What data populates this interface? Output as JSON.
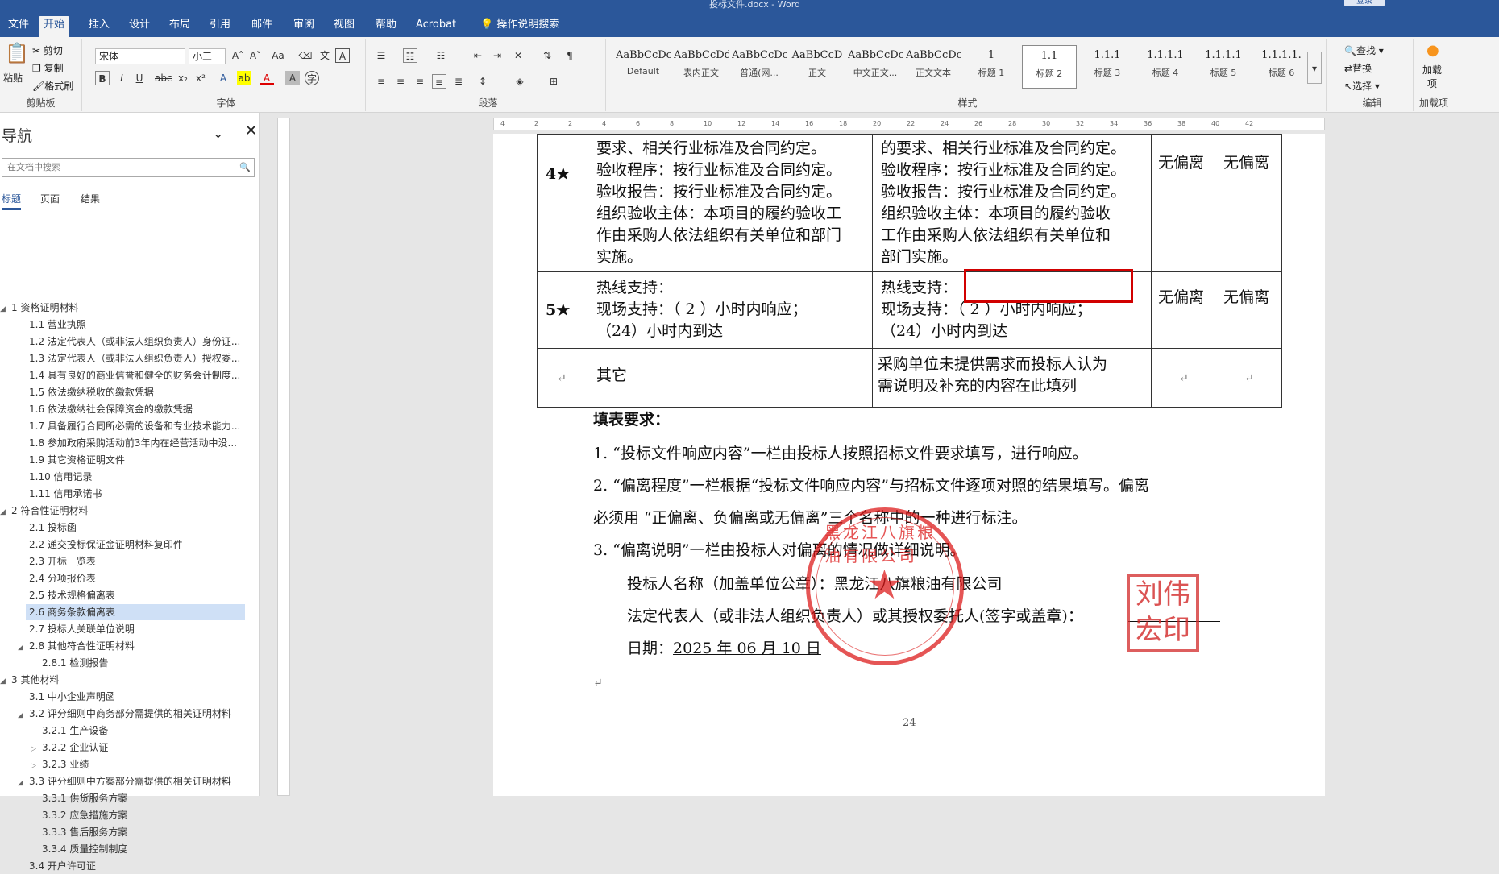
{
  "window": {
    "title": "投标文件.docx - Word",
    "login_btn": "登录"
  },
  "tabs": [
    "文件",
    "开始",
    "插入",
    "设计",
    "布局",
    "引用",
    "邮件",
    "审阅",
    "视图",
    "帮助",
    "Acrobat",
    "操作说明搜索"
  ],
  "clipboard": {
    "paste": "粘贴",
    "cut": "剪切",
    "copy": "复制",
    "format_painter": "格式刷",
    "group": "剪贴板"
  },
  "font": {
    "name": "宋体",
    "size": "小三",
    "group": "字体"
  },
  "paragraph": {
    "group": "段落"
  },
  "styles": {
    "group": "样式",
    "items": [
      {
        "preview": "AaBbCcDc",
        "name": "Default"
      },
      {
        "preview": "AaBbCcDdI",
        "name": "表内正文"
      },
      {
        "preview": "AaBbCcDc",
        "name": "普通(网..."
      },
      {
        "preview": "AaBbCcD",
        "name": "正文"
      },
      {
        "preview": "AaBbCcDc",
        "name": "中文正文..."
      },
      {
        "preview": "AaBbCcDc",
        "name": "正文文本"
      },
      {
        "preview": "1",
        "name": "标题 1"
      },
      {
        "preview": "1.1",
        "name": "标题 2"
      },
      {
        "preview": "1.1.1",
        "name": "标题 3"
      },
      {
        "preview": "1.1.1.1",
        "name": "标题 4"
      },
      {
        "preview": "1.1.1.1",
        "name": "标题 5"
      },
      {
        "preview": "1.1.1.1.",
        "name": "标题 6"
      }
    ]
  },
  "editing": {
    "find": "查找",
    "replace": "替换",
    "select": "选择",
    "group": "编辑"
  },
  "addins": {
    "label": "加载项",
    "group": "加载项"
  },
  "nav": {
    "title": "导航",
    "search_placeholder": "在文档中搜索",
    "tabs": [
      "标题",
      "页面",
      "结果"
    ],
    "items": [
      {
        "lvl": 1,
        "text": "1 资格证明材料",
        "exp": true
      },
      {
        "lvl": 2,
        "text": "1.1 营业执照"
      },
      {
        "lvl": 2,
        "text": "1.2 法定代表人（或非法人组织负责人）身份证..."
      },
      {
        "lvl": 2,
        "text": "1.3 法定代表人（或非法人组织负责人）授权委..."
      },
      {
        "lvl": 2,
        "text": "1.4 具有良好的商业信誉和健全的财务会计制度..."
      },
      {
        "lvl": 2,
        "text": "1.5 依法缴纳税收的缴款凭据"
      },
      {
        "lvl": 2,
        "text": "1.6 依法缴纳社会保障资金的缴款凭据"
      },
      {
        "lvl": 2,
        "text": "1.7 具备履行合同所必需的设备和专业技术能力..."
      },
      {
        "lvl": 2,
        "text": "1.8 参加政府采购活动前3年内在经营活动中没..."
      },
      {
        "lvl": 2,
        "text": "1.9 其它资格证明文件"
      },
      {
        "lvl": 2,
        "text": "1.10 信用记录"
      },
      {
        "lvl": 2,
        "text": "1.11 信用承诺书"
      },
      {
        "lvl": 1,
        "text": "2 符合性证明材料",
        "exp": true
      },
      {
        "lvl": 2,
        "text": "2.1 投标函"
      },
      {
        "lvl": 2,
        "text": "2.2 递交投标保证金证明材料复印件"
      },
      {
        "lvl": 2,
        "text": "2.3 开标一览表"
      },
      {
        "lvl": 2,
        "text": "2.4 分项报价表"
      },
      {
        "lvl": 2,
        "text": "2.5 技术规格偏离表"
      },
      {
        "lvl": 2,
        "text": "2.6 商务条款偏离表",
        "hl": true
      },
      {
        "lvl": 2,
        "text": "2.7 投标人关联单位说明"
      },
      {
        "lvl": 2,
        "text": "2.8 其他符合性证明材料",
        "exp": true
      },
      {
        "lvl": 3,
        "text": "2.8.1 检测报告"
      },
      {
        "lvl": 1,
        "text": "3 其他材料",
        "exp": true
      },
      {
        "lvl": 2,
        "text": "3.1 中小企业声明函"
      },
      {
        "lvl": 2,
        "text": "3.2 评分细则中商务部分需提供的相关证明材料",
        "exp": true
      },
      {
        "lvl": 3,
        "text": "3.2.1 生产设备"
      },
      {
        "lvl": 3,
        "text": "3.2.2 企业认证",
        "col": true
      },
      {
        "lvl": 3,
        "text": "3.2.3 业绩",
        "col": true
      },
      {
        "lvl": 2,
        "text": "3.3 评分细则中方案部分需提供的相关证明材料",
        "exp": true
      },
      {
        "lvl": 3,
        "text": "3.3.1 供货服务方案"
      },
      {
        "lvl": 3,
        "text": "3.3.2 应急措施方案"
      },
      {
        "lvl": 3,
        "text": "3.3.3 售后服务方案"
      },
      {
        "lvl": 3,
        "text": "3.3.4 质量控制制度"
      },
      {
        "lvl": 2,
        "text": "3.4 开户许可证"
      }
    ]
  },
  "ruler": {
    "ticks": [
      "4",
      "2",
      "2",
      "4",
      "6",
      "8",
      "10",
      "12",
      "14",
      "16",
      "18",
      "20",
      "22",
      "24",
      "26",
      "28",
      "30",
      "32",
      "34",
      "36",
      "38",
      "40",
      "42"
    ]
  },
  "doc": {
    "row4": {
      "no": "4★",
      "req": [
        "要求、相关行业标准及合同约定。",
        "验收程序：按行业标准及合同约定。",
        "验收报告：按行业标准及合同约定。",
        "组织验收主体：本项目的履约验收工",
        "作由采购人依法组织有关单位和部门",
        "实施。"
      ],
      "resp": [
        "的要求、相关行业标准及合同约定。",
        "验收程序：按行业标准及合同约定。",
        "验收报告：按行业标准及合同约定。",
        "组织验收主体：本项目的履约验收",
        "工作由采购人依法组织有关单位和",
        "部门实施。"
      ],
      "dev": "无偏离",
      "note": "无偏离"
    },
    "row5": {
      "no": "5★",
      "req": [
        "热线支持：",
        "现场支持：（    2    ）小时内响应；",
        "（24）小时内到达"
      ],
      "resp": [
        "热线支持：",
        "现场支持：（    2    ）小时内响应；",
        "（24）小时内到达"
      ],
      "dev": "无偏离",
      "note": "无偏离"
    },
    "row6": {
      "req": "其它",
      "resp": [
        "采购单位未提供需求而投标人认为",
        "需说明及补充的内容在此填列"
      ]
    },
    "fill_title": "填表要求：",
    "notes": [
      "1. “投标文件响应内容”一栏由投标人按照招标文件要求填写，进行响应。",
      "2. “偏离程度”一栏根据“投标文件响应内容”与招标文件逐项对照的结果填写。偏离",
      "必须用 “正偏离、负偏离或无偏离”三个名称中的一种进行标注。",
      "3. “偏离说明”一栏由投标人对偏离的情况做详细说明。"
    ],
    "bidder_label": "投标人名称（加盖单位公章）：",
    "bidder_name": "黑龙江八旗粮油有限公司",
    "rep_label": "法定代表人（或非法人组织负责人）或其授权委托人(签字或盖章)：",
    "date_label": "日期：",
    "date": "2025 年 06 月 10 日",
    "page_no": "24",
    "seal_text": "黑龙江八旗粮油有限公司",
    "stamp_text": "刘伟宏印"
  }
}
